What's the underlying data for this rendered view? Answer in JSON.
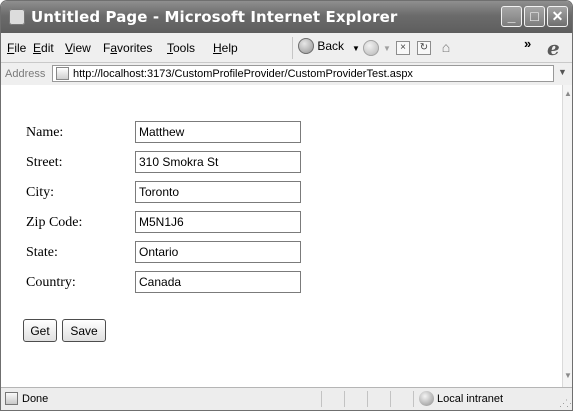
{
  "window": {
    "title": "Untitled Page - Microsoft Internet Explorer",
    "controls": {
      "minimize": "_",
      "maximize": "□",
      "close": "✕"
    }
  },
  "menubar": {
    "items": [
      {
        "label": "File",
        "accel": "F",
        "rest": "ile"
      },
      {
        "label": "Edit",
        "accel": "E",
        "rest": "dit"
      },
      {
        "label": "View",
        "accel": "V",
        "rest": "iew"
      },
      {
        "label": "Favorites",
        "pre": "F",
        "accel": "a",
        "rest": "vorites"
      },
      {
        "label": "Tools",
        "accel": "T",
        "rest": "ools"
      },
      {
        "label": "Help",
        "accel": "H",
        "rest": "elp"
      }
    ],
    "back_label": "Back",
    "dropdown_glyph": "▼",
    "overflow_glyph": "»",
    "logo_glyph": "e",
    "tool_icons": [
      "stop-icon",
      "refresh-icon",
      "home-icon"
    ],
    "tool_glyphs": [
      "×",
      "↻",
      "⌂"
    ]
  },
  "addressbar": {
    "label": "Address",
    "url": "http://localhost:3173/CustomProfileProvider/CustomProviderTest.aspx",
    "dropdown_glyph": "▼"
  },
  "form": {
    "fields": [
      {
        "label": "Name:",
        "value": "Matthew"
      },
      {
        "label": "Street:",
        "value": "310 Smokra St"
      },
      {
        "label": "City:",
        "value": "Toronto"
      },
      {
        "label": "Zip Code:",
        "value": "M5N1J6"
      },
      {
        "label": "State:",
        "value": "Ontario"
      },
      {
        "label": "Country:",
        "value": "Canada"
      }
    ],
    "buttons": {
      "get": "Get",
      "save": "Save"
    }
  },
  "scrollbar": {
    "up_glyph": "▲",
    "down_glyph": "▼"
  },
  "statusbar": {
    "status": "Done",
    "zone": "Local intranet",
    "grip": "⋰⋰"
  },
  "colors": {
    "titlebar": "#6b6b6b",
    "chrome": "#efefef",
    "content": "#ffffff",
    "field_border": "#7b7b7b"
  }
}
